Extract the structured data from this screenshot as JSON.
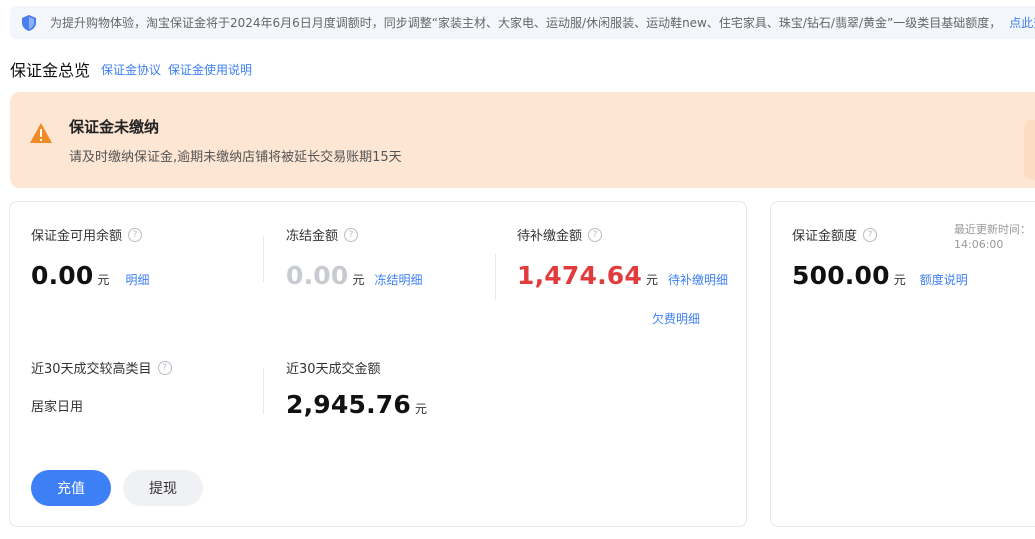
{
  "notice": {
    "icon": "shield-icon",
    "text": "为提升购物体验，淘宝保证金将于2024年6月6日月度调额时，同步调整“家装主材、大家电、运动服/休闲服装、运动鞋new、住宅家具、珠宝/钻石/翡翠/黄金”一级类目基础额度，",
    "link": "点此查看"
  },
  "header": {
    "title": "保证金总览",
    "links": [
      "保证金协议",
      "保证金使用说明"
    ]
  },
  "alert": {
    "icon": "warning-icon",
    "title": "保证金未缴纳",
    "desc": "请及时缴纳保证金,逾期未缴纳店铺将被延长交易账期15天",
    "accent": "#f08a24"
  },
  "balance": {
    "available": {
      "label": "保证金可用余额",
      "value": "0.00",
      "unit": "元",
      "link": "明细"
    },
    "frozen": {
      "label": "冻结金额",
      "value": "0.00",
      "unit": "元",
      "link": "冻结明细"
    },
    "pending": {
      "label": "待补缴金额",
      "value": "1,474.64",
      "unit": "元",
      "link": "待补缴明细",
      "link2": "欠费明细"
    },
    "category": {
      "label": "近30天成交较高类目",
      "value": "居家日用"
    },
    "gmv": {
      "label": "近30天成交金额",
      "value": "2,945.76",
      "unit": "元"
    },
    "buttons": {
      "recharge": "充值",
      "withdraw": "提现"
    }
  },
  "quota": {
    "label": "保证金额度",
    "value": "500.00",
    "unit": "元",
    "link": "额度说明",
    "updated_label": "最近更新时间：",
    "updated_time": "14:06:00"
  },
  "colors": {
    "primary": "#3d7ff5",
    "danger": "#e23b3b",
    "alert_bg": "#fde6d3"
  }
}
